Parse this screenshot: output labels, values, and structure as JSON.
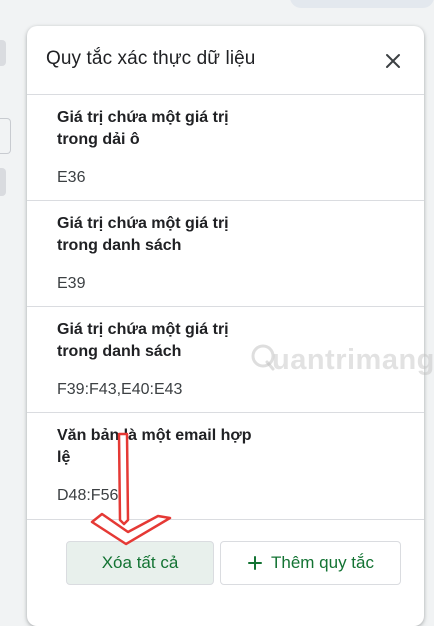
{
  "panel": {
    "title": "Quy tắc xác thực dữ liệu",
    "close_icon": "close-icon"
  },
  "rules": [
    {
      "title": "Giá trị chứa một giá trị trong dải ô",
      "range": "E36"
    },
    {
      "title": "Giá trị chứa một giá trị trong danh sách",
      "range": "E39"
    },
    {
      "title": "Giá trị chứa một giá trị trong danh sách",
      "range": "F39:F43,E40:E43"
    },
    {
      "title": "Văn bản là một email hợp lệ",
      "range": "D48:F56"
    }
  ],
  "footer": {
    "clear_all_label": "Xóa tất cả",
    "add_rule_label": "Thêm quy tắc",
    "add_icon": "plus-icon"
  },
  "overlay": {
    "watermark_text": "uantrimang",
    "arrow_color": "#e53935"
  },
  "colors": {
    "accent": "#137333",
    "clear_button_bg": "#e8f0ec",
    "divider": "#dadce0"
  }
}
